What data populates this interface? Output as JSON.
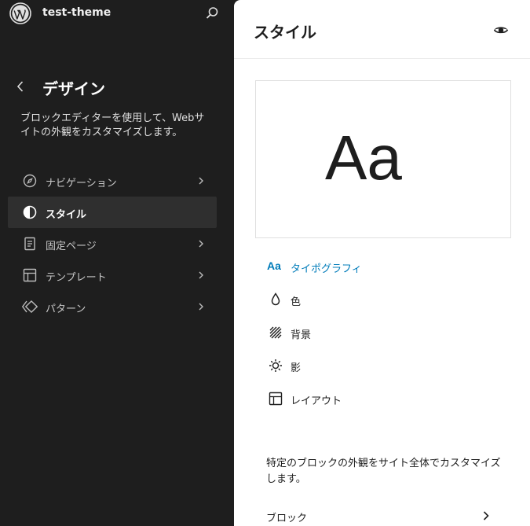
{
  "topbar": {
    "site_name": "test-theme"
  },
  "sidebar": {
    "title": "デザイン",
    "description": "ブロックエディターを使用して、Webサイトの外観をカスタマイズします。",
    "items": [
      {
        "label": "ナビゲーション",
        "icon": "navigation-icon",
        "active": false,
        "has_chevron": true
      },
      {
        "label": "スタイル",
        "icon": "styles-icon",
        "active": true,
        "has_chevron": false
      },
      {
        "label": "固定ページ",
        "icon": "page-icon",
        "active": false,
        "has_chevron": true
      },
      {
        "label": "テンプレート",
        "icon": "layout-icon",
        "active": false,
        "has_chevron": true
      },
      {
        "label": "パターン",
        "icon": "symbol-icon",
        "active": false,
        "has_chevron": true
      }
    ]
  },
  "panel": {
    "title": "スタイル",
    "preview_text": "Aa",
    "menu": [
      {
        "label": "タイポグラフィ",
        "icon": "typography-icon",
        "icon_text": "Aa",
        "active": true
      },
      {
        "label": "色",
        "icon": "color-drop-icon",
        "active": false
      },
      {
        "label": "背景",
        "icon": "background-icon",
        "active": false
      },
      {
        "label": "影",
        "icon": "shadow-sun-icon",
        "active": false
      },
      {
        "label": "レイアウト",
        "icon": "layout-icon",
        "active": false
      }
    ],
    "block_description": "特定のブロックの外観をサイト全体でカスタマイズします。",
    "blocks_label": "ブロック"
  },
  "colors": {
    "sidebar_bg": "#1e1e1e",
    "active_item_bg": "#2f2f2f",
    "accent": "#007cba"
  }
}
